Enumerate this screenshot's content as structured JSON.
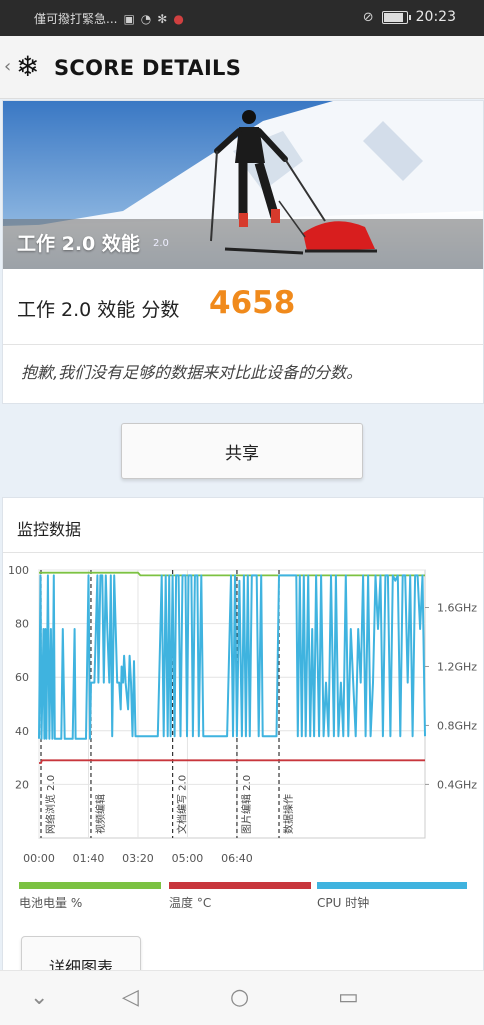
{
  "status_bar": {
    "carrier": "僅可撥打緊急...",
    "time": "20:23",
    "icons": [
      "sim-alert-icon",
      "wifi-icon",
      "snowflake-icon",
      "app-icon",
      "mute-icon",
      "battery-icon"
    ]
  },
  "appbar": {
    "title": "SCORE DETAILS",
    "back_icon": "chevron-left-icon",
    "logo_icon": "snowflake-logo-icon"
  },
  "result": {
    "hero_label": "工作 2.0 效能",
    "hero_version": "2.0",
    "score_label": "工作 2.0 效能 分数",
    "score": "4658",
    "note": "抱歉,我们没有足够的数据来对比此设备的分数。"
  },
  "share_label": "共享",
  "monitor": {
    "title": "监控数据",
    "detail_button": "详细图表"
  },
  "chart_data": {
    "type": "line",
    "y_left_ticks": [
      "100",
      "80",
      "60",
      "40",
      "20"
    ],
    "y_left_range": [
      0,
      100
    ],
    "y_right_ticks": [
      "1.6GHz",
      "1.2GHz",
      "0.8GHz",
      "0.4GHz"
    ],
    "x_ticks": [
      "00:00",
      "01:40",
      "03:20",
      "05:00",
      "06:40"
    ],
    "x_range_seconds": [
      0,
      780
    ],
    "section_labels": [
      {
        "label": "网络浏览 2.0",
        "t": 0
      },
      {
        "label": "视频编辑",
        "t": 105
      },
      {
        "label": "文档编写 2.0",
        "t": 270
      },
      {
        "label": "图片编辑 2.0",
        "t": 400
      },
      {
        "label": "数据操作",
        "t": 485
      }
    ],
    "series": [
      {
        "name": "电池电量 %",
        "color": "#7cc242",
        "points": [
          [
            0,
            99
          ],
          [
            200,
            99
          ],
          [
            205,
            98
          ],
          [
            780,
            98
          ]
        ]
      },
      {
        "name": "温度 °C",
        "color": "#c8363c",
        "points": [
          [
            0,
            28
          ],
          [
            4,
            28
          ],
          [
            6,
            29
          ],
          [
            780,
            29
          ]
        ]
      },
      {
        "name": "CPU 时钟",
        "color": "#3fb3df",
        "points": [
          [
            0,
            37
          ],
          [
            3,
            98
          ],
          [
            5,
            37
          ],
          [
            9,
            78
          ],
          [
            11,
            37
          ],
          [
            13,
            78
          ],
          [
            15,
            37
          ],
          [
            18,
            98
          ],
          [
            21,
            37
          ],
          [
            24,
            78
          ],
          [
            27,
            37
          ],
          [
            30,
            98
          ],
          [
            32,
            37
          ],
          [
            40,
            37
          ],
          [
            45,
            37
          ],
          [
            48,
            78
          ],
          [
            52,
            37
          ],
          [
            60,
            37
          ],
          [
            68,
            37
          ],
          [
            72,
            78
          ],
          [
            74,
            37
          ],
          [
            88,
            37
          ],
          [
            95,
            37
          ],
          [
            100,
            98
          ],
          [
            103,
            37
          ],
          [
            105,
            58
          ],
          [
            112,
            58
          ],
          [
            118,
            98
          ],
          [
            120,
            58
          ],
          [
            124,
            98
          ],
          [
            128,
            98
          ],
          [
            131,
            58
          ],
          [
            135,
            98
          ],
          [
            138,
            78
          ],
          [
            142,
            58
          ],
          [
            145,
            98
          ],
          [
            148,
            38
          ],
          [
            152,
            98
          ],
          [
            155,
            78
          ],
          [
            158,
            58
          ],
          [
            162,
            58
          ],
          [
            165,
            48
          ],
          [
            167,
            64
          ],
          [
            170,
            58
          ],
          [
            172,
            68
          ],
          [
            175,
            58
          ],
          [
            180,
            48
          ],
          [
            183,
            68
          ],
          [
            186,
            58
          ],
          [
            189,
            38
          ],
          [
            192,
            66
          ],
          [
            195,
            38
          ],
          [
            198,
            38
          ],
          [
            230,
            38
          ],
          [
            240,
            38
          ],
          [
            248,
            98
          ],
          [
            252,
            38
          ],
          [
            256,
            98
          ],
          [
            260,
            38
          ],
          [
            263,
            98
          ],
          [
            266,
            38
          ],
          [
            270,
            98
          ],
          [
            274,
            38
          ],
          [
            277,
            98
          ],
          [
            282,
            98
          ],
          [
            286,
            38
          ],
          [
            290,
            98
          ],
          [
            296,
            98
          ],
          [
            299,
            38
          ],
          [
            302,
            98
          ],
          [
            308,
            98
          ],
          [
            311,
            38
          ],
          [
            315,
            98
          ],
          [
            320,
            98
          ],
          [
            323,
            38
          ],
          [
            328,
            98
          ],
          [
            332,
            38
          ],
          [
            340,
            38
          ],
          [
            360,
            38
          ],
          [
            380,
            38
          ],
          [
            388,
            98
          ],
          [
            392,
            38
          ],
          [
            396,
            98
          ],
          [
            400,
            38
          ],
          [
            405,
            96
          ],
          [
            410,
            38
          ],
          [
            414,
            98
          ],
          [
            418,
            38
          ],
          [
            422,
            98
          ],
          [
            426,
            38
          ],
          [
            430,
            98
          ],
          [
            440,
            98
          ],
          [
            444,
            38
          ],
          [
            449,
            98
          ],
          [
            452,
            38
          ],
          [
            460,
            38
          ],
          [
            470,
            38
          ],
          [
            480,
            38
          ],
          [
            485,
            98
          ],
          [
            500,
            98
          ],
          [
            520,
            98
          ],
          [
            523,
            38
          ],
          [
            527,
            98
          ],
          [
            531,
            38
          ],
          [
            535,
            98
          ],
          [
            539,
            38
          ],
          [
            544,
            98
          ],
          [
            548,
            38
          ],
          [
            552,
            78
          ],
          [
            556,
            38
          ],
          [
            560,
            98
          ],
          [
            566,
            38
          ],
          [
            570,
            98
          ],
          [
            575,
            38
          ],
          [
            580,
            58
          ],
          [
            585,
            38
          ],
          [
            590,
            98
          ],
          [
            596,
            38
          ],
          [
            600,
            98
          ],
          [
            605,
            38
          ],
          [
            610,
            58
          ],
          [
            615,
            38
          ],
          [
            620,
            98
          ],
          [
            625,
            38
          ],
          [
            630,
            78
          ],
          [
            635,
            58
          ],
          [
            640,
            38
          ],
          [
            645,
            78
          ],
          [
            650,
            58
          ],
          [
            655,
            98
          ],
          [
            660,
            38
          ],
          [
            665,
            98
          ],
          [
            670,
            38
          ],
          [
            675,
            58
          ],
          [
            680,
            98
          ],
          [
            685,
            78
          ],
          [
            690,
            98
          ],
          [
            695,
            38
          ],
          [
            700,
            98
          ],
          [
            705,
            98
          ],
          [
            710,
            38
          ],
          [
            715,
            98
          ],
          [
            720,
            96
          ],
          [
            725,
            98
          ],
          [
            730,
            38
          ],
          [
            735,
            98
          ],
          [
            740,
            98
          ],
          [
            745,
            58
          ],
          [
            750,
            98
          ],
          [
            755,
            38
          ],
          [
            760,
            98
          ],
          [
            765,
            98
          ],
          [
            770,
            78
          ],
          [
            775,
            98
          ],
          [
            780,
            38
          ]
        ]
      }
    ]
  },
  "legend": [
    {
      "label": "电池电量 %",
      "color": "#7cc242"
    },
    {
      "label": "温度 °C",
      "color": "#c8363c"
    },
    {
      "label": "CPU 时钟",
      "color": "#3fb3df"
    }
  ],
  "nav": [
    "chevron-down-icon",
    "back-triangle-icon",
    "home-circle-icon",
    "recents-square-icon"
  ]
}
